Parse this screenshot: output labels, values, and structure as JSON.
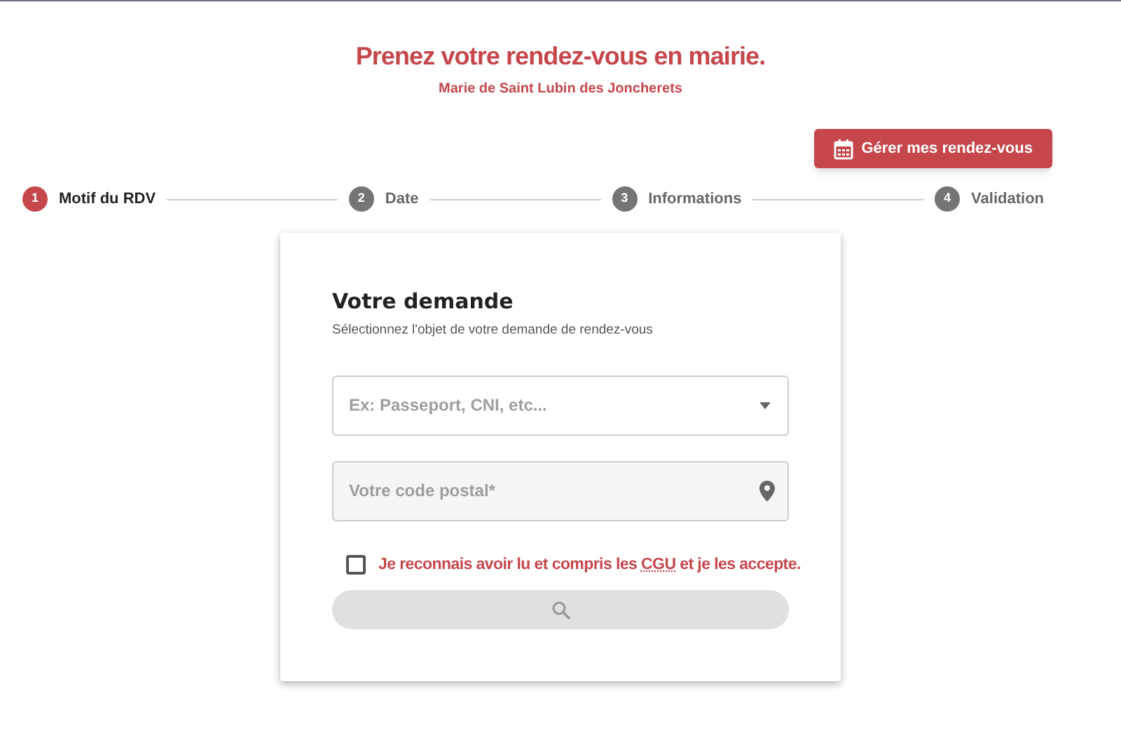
{
  "header": {
    "title": "Prenez votre rendez-vous en mairie.",
    "subtitle": "Marie de Saint Lubin des Joncherets"
  },
  "manage_button": {
    "label": "Gérer mes rendez-vous"
  },
  "steps": [
    {
      "number": "1",
      "label": "Motif du RDV",
      "selected": true
    },
    {
      "number": "2",
      "label": "Date",
      "selected": false
    },
    {
      "number": "3",
      "label": "Informations",
      "selected": false
    },
    {
      "number": "4",
      "label": "Validation",
      "selected": false
    }
  ],
  "form": {
    "title": "Votre demande",
    "subtitle": "Sélectionnez l'objet de votre demande de rendez-vous",
    "reason_select": {
      "placeholder": "Ex: Passeport, CNI, etc..."
    },
    "postal_code": {
      "placeholder": "Votre code postal*"
    },
    "terms": {
      "checked": false,
      "text_before": "Je reconnais avoir lu et compris les",
      "link": "CGU",
      "text_after": "et je les accepte."
    },
    "search_button": {
      "disabled": true
    }
  }
}
